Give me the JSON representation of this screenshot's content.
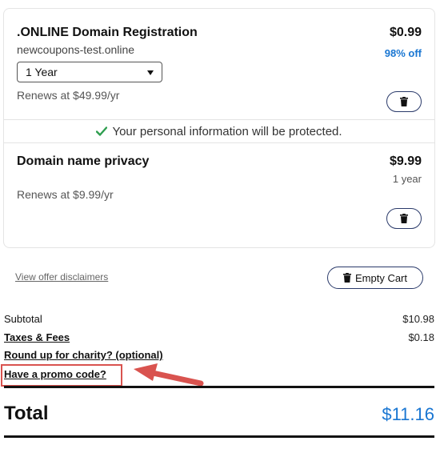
{
  "cart": {
    "items": [
      {
        "title": ".ONLINE Domain Registration",
        "domain": "newcoupons-test.online",
        "price": "$0.99",
        "discount": "98% off",
        "term_selected": "1 Year",
        "renews": "Renews at $49.99/yr"
      },
      {
        "title": "Domain name privacy",
        "price": "$9.99",
        "term": "1 year",
        "renews": "Renews at $9.99/yr"
      }
    ],
    "protection_message": "Your personal information will be protected."
  },
  "actions": {
    "disclaimer_link": "View offer disclaimers",
    "empty_cart_label": "Empty Cart"
  },
  "summary": {
    "subtotal_label": "Subtotal",
    "subtotal_value": "$10.98",
    "taxes_label": "Taxes & Fees",
    "taxes_value": "$0.18",
    "charity_label": "Round up for charity? (optional)",
    "promo_label": "Have a promo code?",
    "total_label": "Total",
    "total_value": "$11.16"
  },
  "colors": {
    "accent_blue": "#1976d2",
    "check_green": "#2e9e4f",
    "annotation_red": "#d9534f",
    "button_border": "#2a3a6a"
  },
  "icons": {
    "delete": "trash-icon",
    "check": "check-icon",
    "select_caret": "caret-down-icon",
    "annotation": "red-arrow-icon"
  }
}
